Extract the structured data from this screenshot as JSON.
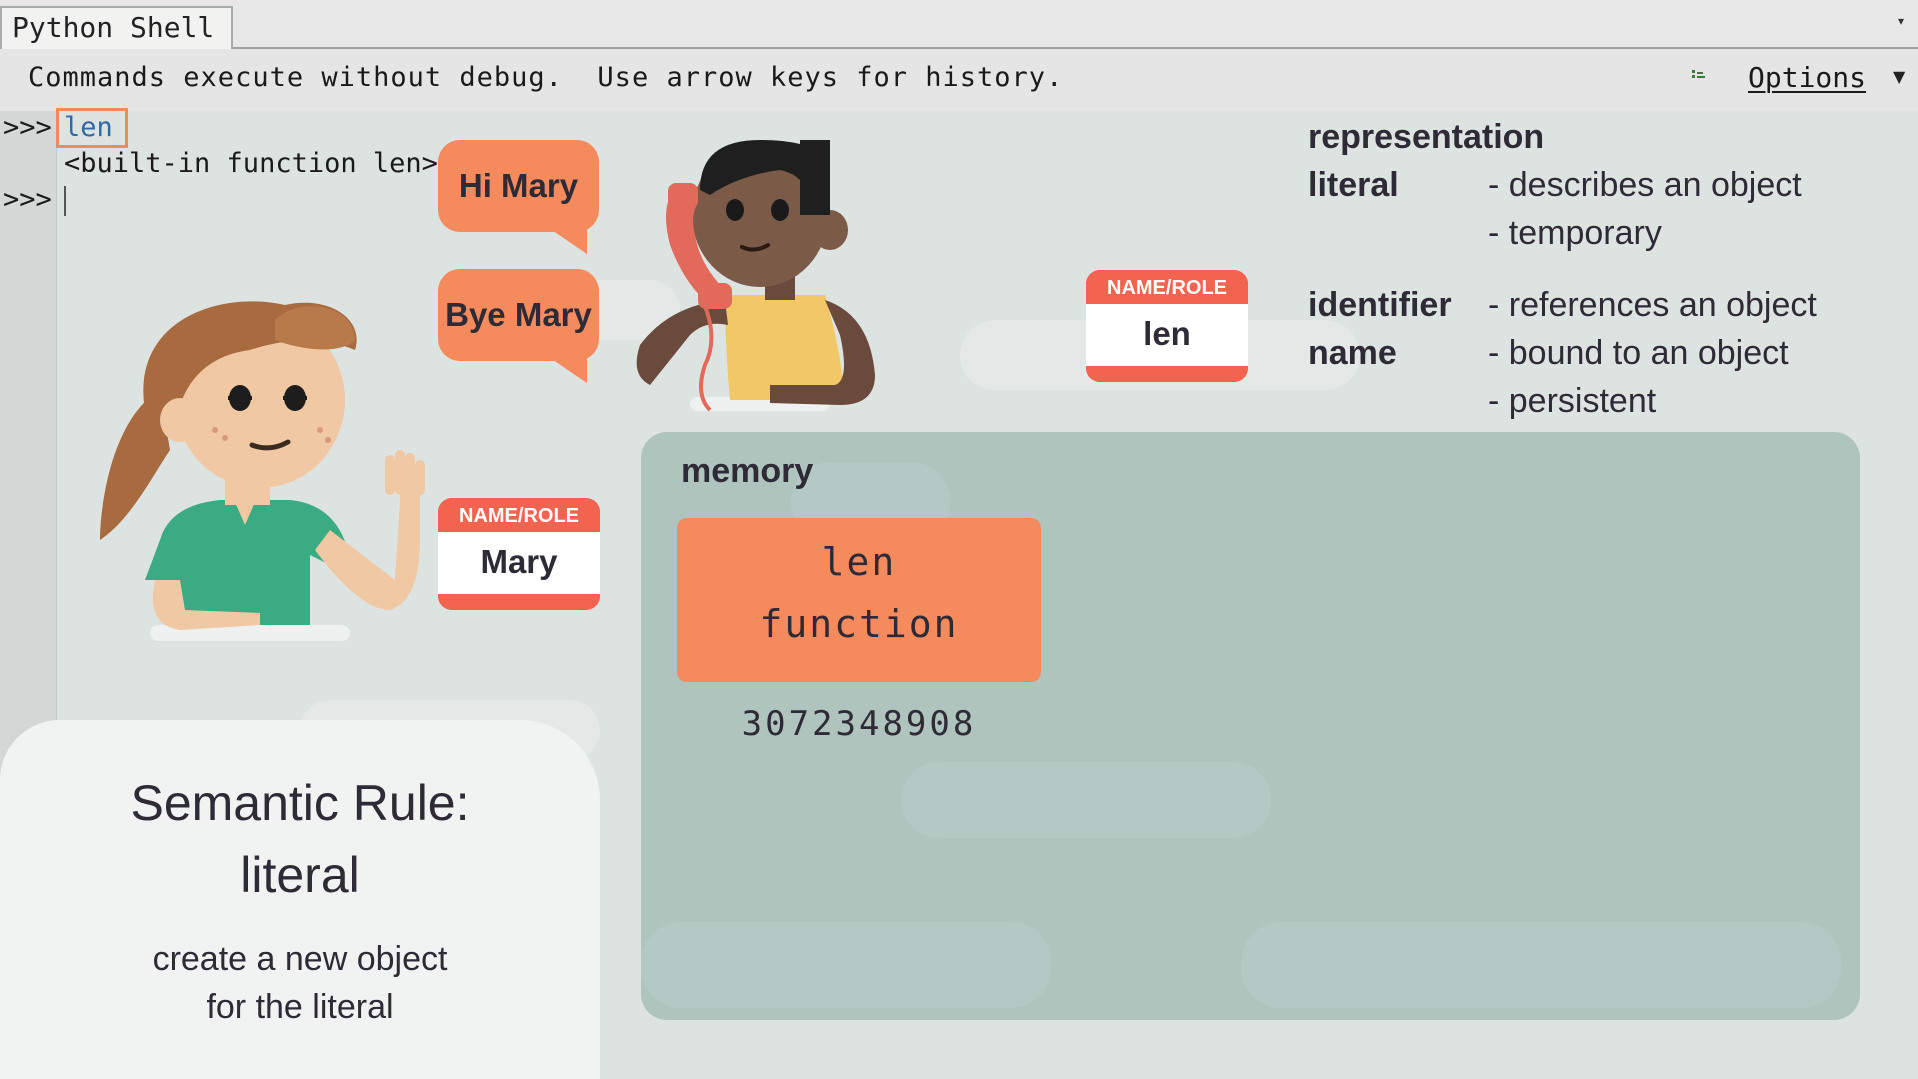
{
  "shell": {
    "tab_title": "Python Shell",
    "hint": "Commands execute without debug.  Use arrow keys for history.",
    "options_label": "Options",
    "prompt": ">>>",
    "command": "len",
    "output": "<built-in function len>"
  },
  "bubbles": {
    "hi": "Hi Mary",
    "bye": "Bye Mary"
  },
  "tags": {
    "person": {
      "header": "NAME/ROLE",
      "name": "Mary"
    },
    "function": {
      "header": "NAME/ROLE",
      "name": "len"
    }
  },
  "glossary": {
    "heading": "representation",
    "literal_term": "literal",
    "literal_points": [
      "- describes an object",
      "- temporary"
    ],
    "identifier_term": "identifier",
    "name_term": "name",
    "identifier_points": [
      "- references an object",
      "- bound to an object",
      "- persistent"
    ]
  },
  "memory": {
    "title": "memory",
    "object_line1": "len",
    "object_line2": "function",
    "address": "3072348908"
  },
  "rule": {
    "title_line1": "Semantic Rule:",
    "title_line2": "literal",
    "desc_line1": "create a new object",
    "desc_line2": "for the literal"
  },
  "colors": {
    "accent_orange": "#f58a5d",
    "tag_red": "#f26350",
    "memory_panel": "#aec4bd",
    "background": "#dde3e1"
  }
}
